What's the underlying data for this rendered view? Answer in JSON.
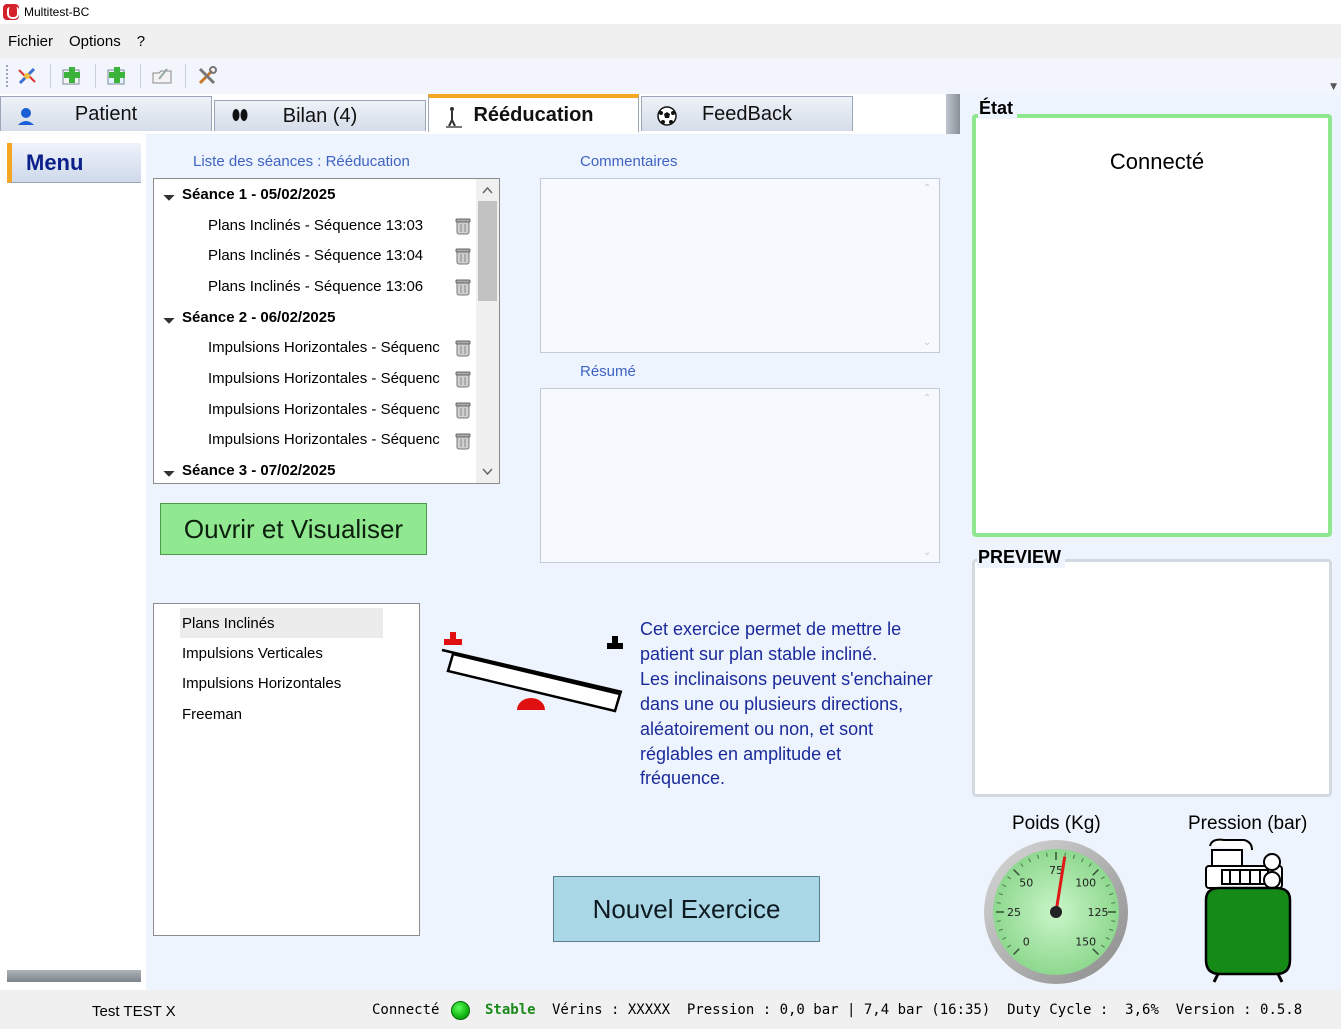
{
  "window": {
    "title": "Multitest-BC"
  },
  "menubar": {
    "items": [
      "Fichier",
      "Options",
      "?"
    ]
  },
  "toolbar": {
    "buttons": [
      "connect-icon",
      "add-patient-icon",
      "add-session-icon",
      "open-folder-icon",
      "tools-icon"
    ]
  },
  "tabs": [
    {
      "label": "Patient",
      "icon": "person-icon",
      "active": false
    },
    {
      "label": "Bilan (4)",
      "icon": "footprints-icon",
      "active": false
    },
    {
      "label": "Rééducation",
      "icon": "standing-figure-icon",
      "active": true
    },
    {
      "label": "FeedBack",
      "icon": "soccer-ball-icon",
      "active": false
    }
  ],
  "left_menu": {
    "label": "Menu"
  },
  "sessions": {
    "title": "Liste des séances : Rééducation",
    "groups": [
      {
        "label": "Séance 1 - 05/02/2025",
        "items": [
          "Plans Inclinés - Séquence 13:03",
          "Plans Inclinés - Séquence 13:04",
          "Plans Inclinés - Séquence 13:06"
        ]
      },
      {
        "label": "Séance 2 - 06/02/2025",
        "items": [
          "Impulsions Horizontales - Séquenc",
          "Impulsions Horizontales - Séquenc",
          "Impulsions Horizontales - Séquenc",
          "Impulsions Horizontales - Séquenc"
        ]
      },
      {
        "label": "Séance 3 - 07/02/2025",
        "items": []
      }
    ]
  },
  "comments": {
    "title": "Commentaires",
    "value": ""
  },
  "resume": {
    "title": "Résumé",
    "value": ""
  },
  "buttons": {
    "open": "Ouvrir et Visualiser",
    "new_exercise": "Nouvel Exercice"
  },
  "exercises": {
    "items": [
      "Plans Inclinés",
      "Impulsions Verticales",
      "Impulsions Horizontales",
      "Freeman"
    ],
    "selected": 0
  },
  "description": {
    "lines": [
      "Cet exercice permet de mettre le",
      "patient sur plan stable incliné.",
      "Les inclinaisons peuvent s'enchainer",
      "dans une ou plusieurs directions,",
      "aléatoirement ou non, et sont",
      "réglables en amplitude et",
      "fréquence."
    ]
  },
  "etat": {
    "title": "État",
    "status": "Connecté",
    "border_color": "#8ee68e"
  },
  "preview": {
    "title": "PREVIEW"
  },
  "gauges": {
    "poids": {
      "label": "Poids (Kg)",
      "ticks": [
        "0",
        "25",
        "50",
        "75",
        "100",
        "125",
        "150"
      ],
      "max": 150,
      "value": 80
    },
    "pression": {
      "label": "Pression (bar)"
    }
  },
  "statusbar": {
    "user": "Test TEST  X",
    "connection": "Connecté",
    "stability": "Stable",
    "details": "Vérins : XXXXX  Pression : 0,0 bar | 7,4 bar (16:35)  Duty Cycle :  3,6%  Version : 0.5.8"
  },
  "colors": {
    "accent": "#f5a623",
    "menu_text": "#0b1f8a",
    "label_blue": "#3e63c3",
    "description_blue": "#1a2a9a",
    "open_button": "#90e890",
    "new_button": "#a9d7e6",
    "status_green": "#1a8a1a"
  }
}
